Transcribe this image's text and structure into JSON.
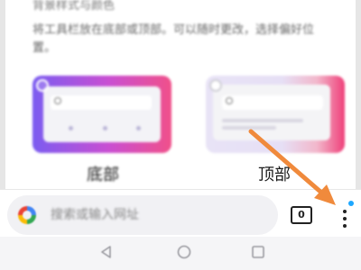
{
  "sheet": {
    "top_partial_text": "背景样式与颜色",
    "description": "将工具栏放在底部或顶部。可以随时更改，选择偏好位置。",
    "options": {
      "bottom": {
        "label": "底部",
        "selected": true
      },
      "top": {
        "label": "顶部",
        "selected": false
      }
    }
  },
  "bottom_bar": {
    "url_placeholder": "搜索或输入网址",
    "tab_count": "0",
    "menu_has_badge": true
  },
  "colors": {
    "accent_gradient_start": "#7b5cf0",
    "accent_gradient_end": "#f0508a",
    "annotation_arrow": "#f08a3c",
    "badge": "#1ea7ff"
  },
  "icons": {
    "search_engine": "google-g-icon",
    "tabs": "tab-counter-icon",
    "menu": "kebab-menu-icon",
    "nav_back": "back-triangle-icon",
    "nav_home": "home-circle-icon",
    "nav_recents": "recents-square-icon"
  }
}
